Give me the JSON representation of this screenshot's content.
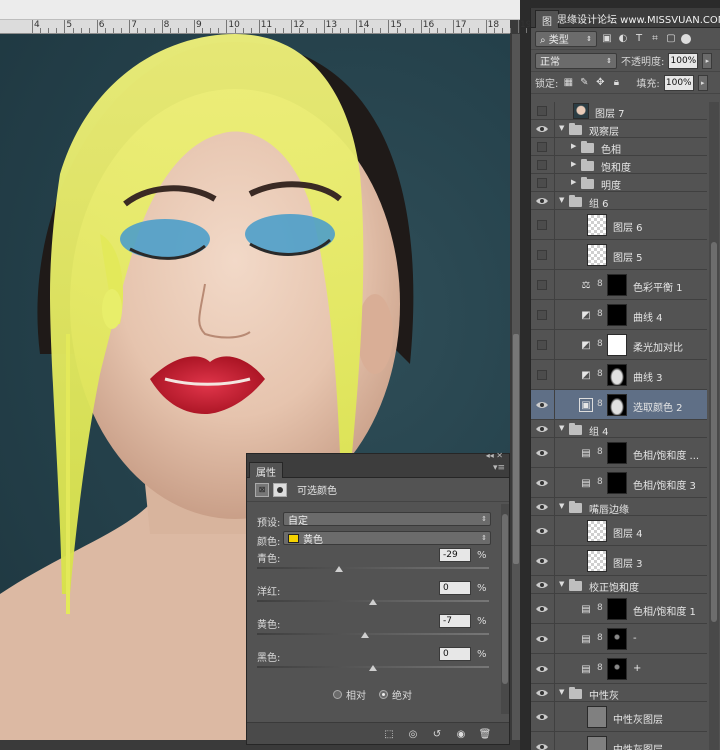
{
  "ruler": {
    "numbers": [
      "4",
      "5",
      "6",
      "7",
      "8",
      "9",
      "10",
      "11",
      "12",
      "13",
      "14",
      "15",
      "16",
      "17",
      "18",
      "19"
    ]
  },
  "layers_panel": {
    "tab": "图",
    "watermark": "思缘设计论坛 www.MISSVUAN.COM",
    "filter_kind": "类型",
    "blend_mode": "正常",
    "opacity_label": "不透明度:",
    "opacity_value": "100%",
    "lock_label": "锁定:",
    "fill_label": "填充:",
    "fill_value": "100%",
    "items": [
      {
        "name": "图层 7",
        "type": "photo",
        "indent": 1,
        "visible": false
      },
      {
        "name": "观察层",
        "type": "group",
        "indent": 0,
        "visible": true,
        "open": true
      },
      {
        "name": "色相",
        "type": "group",
        "indent": 1,
        "visible": false,
        "open": false
      },
      {
        "name": "饱和度",
        "type": "group",
        "indent": 1,
        "visible": false,
        "open": false
      },
      {
        "name": "明度",
        "type": "group",
        "indent": 1,
        "visible": false,
        "open": false
      },
      {
        "name": "组 6",
        "type": "group",
        "indent": 0,
        "visible": true,
        "open": true
      },
      {
        "name": "图层 6",
        "type": "pixel",
        "indent": 1,
        "visible": false
      },
      {
        "name": "图层 5",
        "type": "pixel",
        "indent": 1,
        "visible": false
      },
      {
        "name": "色彩平衡 1",
        "type": "adj",
        "icon": "⚖",
        "mask": "black",
        "indent": 1,
        "visible": false
      },
      {
        "name": "曲线 4",
        "type": "adj",
        "icon": "◩",
        "mask": "black",
        "indent": 1,
        "visible": false
      },
      {
        "name": "柔光加对比",
        "type": "adj",
        "icon": "◩",
        "mask": "white",
        "indent": 1,
        "visible": false
      },
      {
        "name": "曲线 3",
        "type": "adj",
        "icon": "◩",
        "mask": "face",
        "indent": 1,
        "visible": false
      },
      {
        "name": "选取颜色 2",
        "type": "adj",
        "icon": "▣",
        "mask": "face",
        "indent": 1,
        "visible": true,
        "selected": true
      },
      {
        "name": "组 4",
        "type": "group",
        "indent": 0,
        "visible": true,
        "open": true
      },
      {
        "name": "色相/饱和度 ...",
        "type": "adj",
        "icon": "▤",
        "mask": "black",
        "indent": 1,
        "visible": true
      },
      {
        "name": "色相/饱和度 3",
        "type": "adj",
        "icon": "▤",
        "mask": "black",
        "indent": 1,
        "visible": true
      },
      {
        "name": "嘴唇边缘",
        "type": "group",
        "indent": 0,
        "visible": true,
        "open": true
      },
      {
        "name": "图层 4",
        "type": "pixel",
        "indent": 1,
        "visible": true
      },
      {
        "name": "图层 3",
        "type": "pixel",
        "indent": 1,
        "visible": true
      },
      {
        "name": "校正饱和度",
        "type": "group",
        "indent": 0,
        "visible": true,
        "open": true
      },
      {
        "name": "色相/饱和度 1",
        "type": "adj",
        "icon": "▤",
        "mask": "black",
        "indent": 1,
        "visible": true
      },
      {
        "name": "-",
        "type": "adj",
        "icon": "▤",
        "mask": "dots",
        "indent": 1,
        "visible": true
      },
      {
        "name": "+",
        "type": "adj",
        "icon": "▤",
        "mask": "dots",
        "indent": 1,
        "visible": true
      },
      {
        "name": "中性灰",
        "type": "group",
        "indent": 0,
        "visible": true,
        "open": true
      },
      {
        "name": "中性灰图层",
        "type": "gray",
        "indent": 1,
        "visible": true
      },
      {
        "name": "中性灰图层",
        "type": "gray",
        "indent": 1,
        "visible": true
      }
    ]
  },
  "properties_panel": {
    "tab": "属性",
    "title": "可选颜色",
    "preset_label": "预设:",
    "preset_value": "自定",
    "color_label": "颜色:",
    "color_value": "黄色",
    "color_swatch": "#f5d200",
    "sliders": [
      {
        "label": "青色:",
        "value": -29
      },
      {
        "label": "洋红:",
        "value": 0
      },
      {
        "label": "黄色:",
        "value": -7
      },
      {
        "label": "黑色:",
        "value": 0
      }
    ],
    "percent": "%",
    "relative_label": "相对",
    "absolute_label": "绝对",
    "method": "absolute"
  }
}
